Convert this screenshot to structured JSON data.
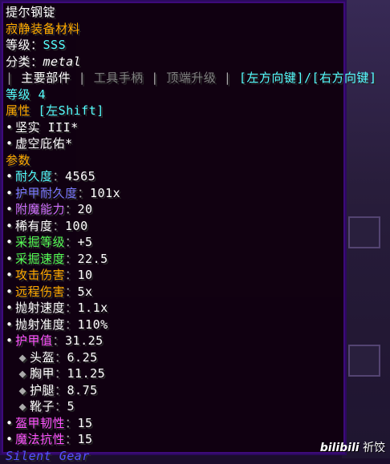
{
  "item": {
    "name": "提尔钢锭",
    "rarity": "寂静装备材料",
    "tier_label": "等级：",
    "tier_value": "SSS",
    "category_label": "分类：",
    "category_value": "metal"
  },
  "tabs": {
    "sep1": "|",
    "main": "主要部件",
    "sep2": "|",
    "tool_rod": "工具手柄",
    "sep3": "|",
    "tip": "顶端升级",
    "sep4": "|",
    "hint": "[左方向键]/[右方向键]"
  },
  "level": "等级 4",
  "traits": {
    "header": "属性",
    "key_hint": "[左Shift]",
    "items": [
      "坚实 III*",
      "虚空庇佑*"
    ]
  },
  "stats": {
    "header": "参数",
    "items": [
      {
        "label": "耐久度",
        "sep": "：",
        "value": "4565"
      },
      {
        "label": "护甲耐久度",
        "sep": "：",
        "value": "101x"
      },
      {
        "label": "附魔能力",
        "sep": "：",
        "value": "20"
      },
      {
        "label": "稀有度",
        "sep": "：",
        "value": "100"
      },
      {
        "label": "采掘等级",
        "sep": "：",
        "value": "+5"
      },
      {
        "label": "采掘速度",
        "sep": "：",
        "value": "22.5"
      },
      {
        "label": "攻击伤害",
        "sep": "：",
        "value": "10"
      },
      {
        "label": "远程伤害",
        "sep": "：",
        "value": "5x"
      },
      {
        "label": "抛射速度",
        "sep": "：",
        "value": "1.1x"
      },
      {
        "label": "抛射准度",
        "sep": "：",
        "value": "110%"
      },
      {
        "label": "护甲值",
        "sep": "：",
        "value": "31.25"
      },
      {
        "label": "头盔",
        "sep": "：",
        "value": "6.25"
      },
      {
        "label": "胸甲",
        "sep": "：",
        "value": "11.25"
      },
      {
        "label": "护腿",
        "sep": "：",
        "value": "8.75"
      },
      {
        "label": "靴子",
        "sep": "：",
        "value": "5"
      },
      {
        "label": "盔甲韧性",
        "sep": "：",
        "value": "15"
      },
      {
        "label": "魔法抗性",
        "sep": "：",
        "value": "15"
      }
    ]
  },
  "mod_name": "Silent Gear",
  "watermark": {
    "logo": "bilibili",
    "user": "祈饺"
  },
  "colors": {
    "name": "#ffffff",
    "rarity": "#ffaa00",
    "tier": "#55ffff",
    "trait_header": "#ffaa00",
    "stat_header": "#ffaa00",
    "durability": "#55ffff",
    "armor_durability": "#5555ff",
    "enchantability": "#d070ff",
    "rarity_stat": "#ffffff",
    "harvest": "#55ff55",
    "attack": "#ffaa00",
    "armor": "#ff55ff",
    "mod": "#5555ff"
  }
}
